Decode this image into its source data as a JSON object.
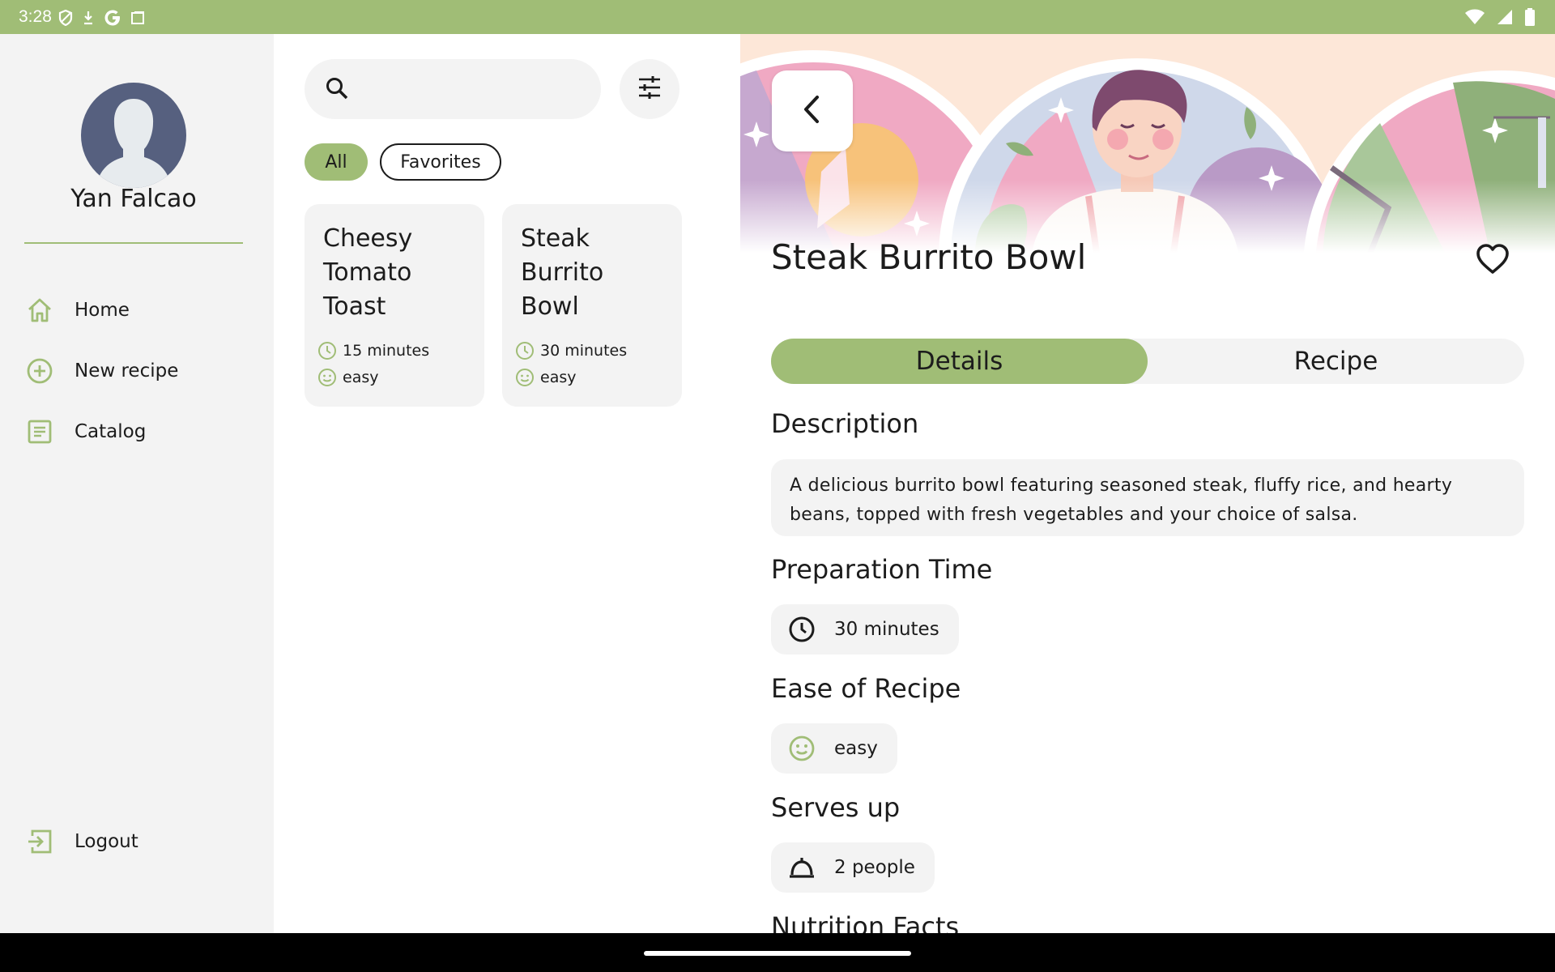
{
  "status_bar": {
    "time": "3:28"
  },
  "nav": {
    "user_name": "Yan Falcao",
    "items": [
      {
        "label": "Home",
        "icon": "home-icon"
      },
      {
        "label": "New recipe",
        "icon": "add-circle-icon"
      },
      {
        "label": "Catalog",
        "icon": "list-document-icon"
      }
    ],
    "logout_label": "Logout"
  },
  "list": {
    "filters": {
      "all": "All",
      "favorites": "Favorites",
      "selected": "All"
    },
    "cards": [
      {
        "title": "Cheesy Tomato Toast",
        "time": "15 minutes",
        "difficulty": "easy"
      },
      {
        "title": "Steak Burrito Bowl",
        "time": "30 minutes",
        "difficulty": "easy"
      }
    ]
  },
  "detail": {
    "title": "Steak Burrito Bowl",
    "tabs": {
      "details": "Details",
      "recipe": "Recipe",
      "selected": "Details"
    },
    "description_heading": "Description",
    "description": "A delicious burrito bowl featuring seasoned steak, fluffy rice, and hearty beans, topped with fresh vegetables and your choice of salsa.",
    "prep_heading": "Preparation Time",
    "prep_time": "30 minutes",
    "ease_heading": "Ease of Recipe",
    "ease": "easy",
    "serves_heading": "Serves up",
    "serves": "2 people",
    "nutrition_heading": "Nutrition Facts"
  },
  "colors": {
    "accent": "#a0bd76",
    "surface": "#f3f3f3",
    "text": "#1c1c1c",
    "avatar": "#56607f"
  }
}
